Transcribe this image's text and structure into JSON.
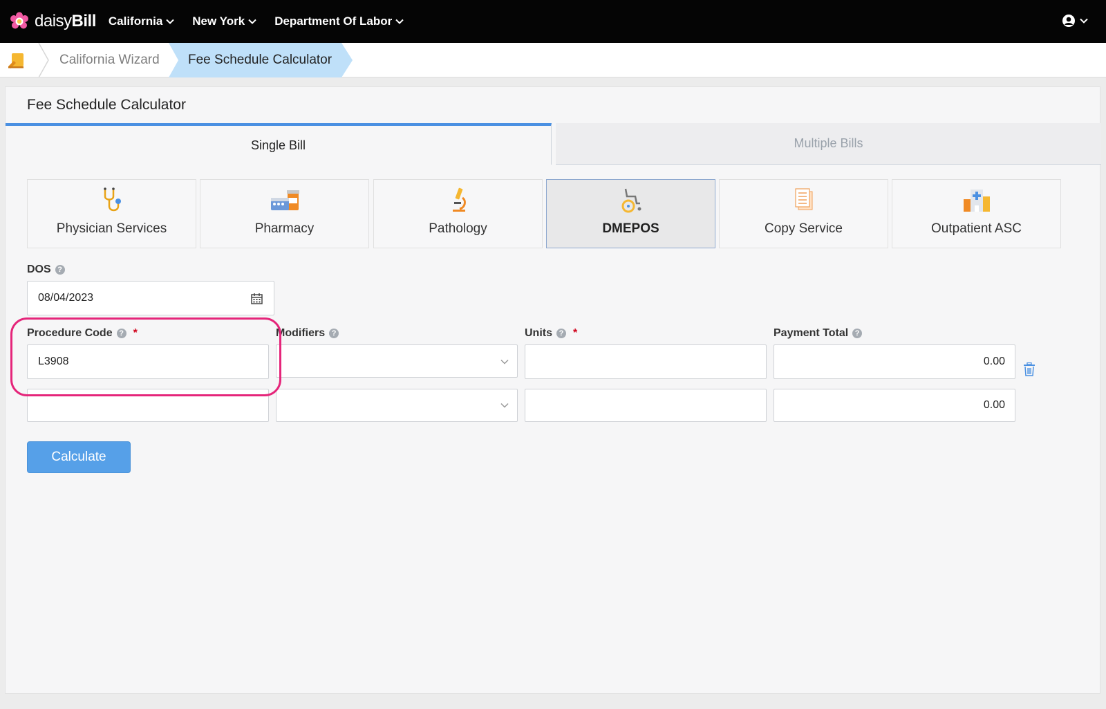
{
  "brand": {
    "name_light": "daisy",
    "name_bold": "Bill"
  },
  "topnav": {
    "items": [
      {
        "label": "California"
      },
      {
        "label": "New York"
      },
      {
        "label": "Department Of Labor"
      }
    ]
  },
  "breadcrumb": {
    "link": "California Wizard",
    "active": "Fee Schedule Calculator"
  },
  "panel": {
    "title": "Fee Schedule Calculator",
    "tabs": [
      {
        "label": "Single Bill",
        "active": true
      },
      {
        "label": "Multiple Bills",
        "active": false
      }
    ],
    "categories": [
      {
        "label": "Physician Services",
        "icon": "stethoscope-icon"
      },
      {
        "label": "Pharmacy",
        "icon": "pharmacy-icon"
      },
      {
        "label": "Pathology",
        "icon": "microscope-icon"
      },
      {
        "label": "DMEPOS",
        "icon": "wheelchair-icon",
        "selected": true
      },
      {
        "label": "Copy Service",
        "icon": "document-icon"
      },
      {
        "label": "Outpatient ASC",
        "icon": "hospital-icon"
      }
    ]
  },
  "form": {
    "dos_label": "DOS",
    "dos_value": "08/04/2023",
    "procedure_label": "Procedure Code",
    "modifiers_label": "Modifiers",
    "units_label": "Units",
    "payment_label": "Payment Total",
    "required_mark": "*",
    "rows": [
      {
        "procedure": "L3908",
        "modifiers": "",
        "units": "",
        "payment": "0.00"
      },
      {
        "procedure": "",
        "modifiers": "",
        "units": "",
        "payment": "0.00"
      }
    ],
    "calculate_label": "Calculate"
  },
  "colors": {
    "accent": "#4a90e2",
    "highlight": "#e5257a",
    "button": "#56a0e8"
  }
}
